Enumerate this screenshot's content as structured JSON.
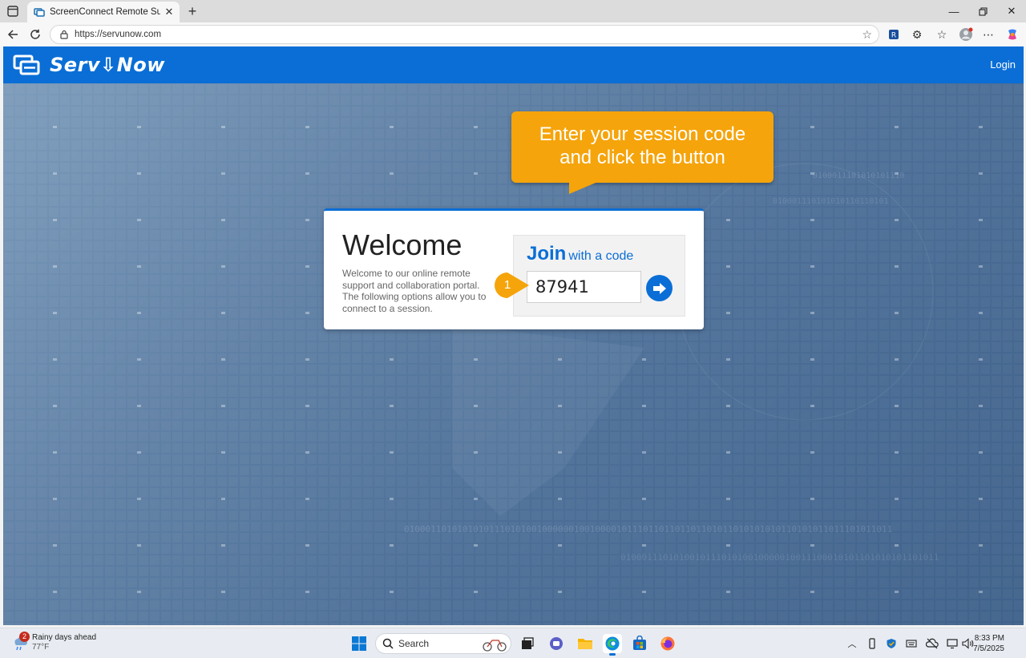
{
  "browser": {
    "tab_title": "ScreenConnect Remote Support S",
    "url": "https://servunow.com"
  },
  "site": {
    "logo_text": "Serv⇩Now",
    "login_label": "Login"
  },
  "callout": {
    "line1": "Enter your session code",
    "line2": "and click the button"
  },
  "welcome": {
    "title": "Welcome",
    "text": "Welcome to our online remote support and collaboration portal. The following options allow you to connect to a session.",
    "join_label": "Join",
    "join_sub": "with a code",
    "code_value": "87941",
    "step_number": "1"
  },
  "taskbar": {
    "weather_title": "Rainy days ahead",
    "weather_temp": "77°F",
    "weather_badge": "2",
    "search_label": "Search",
    "time": "8:33 PM",
    "date": "7/5/2025"
  },
  "colors": {
    "accent": "#0a6ed6",
    "callout": "#f5a40b"
  }
}
